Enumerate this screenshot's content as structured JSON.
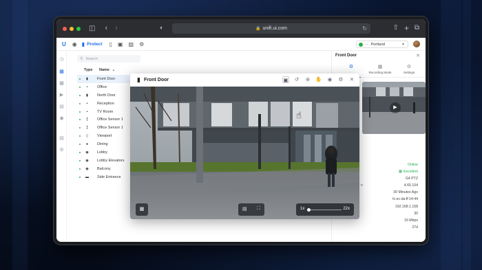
{
  "browser": {
    "url": "unifi.ui.com",
    "traffic_colors": [
      "#ff5f57",
      "#febc2e",
      "#28c840"
    ]
  },
  "toolbar": {
    "protect_label": "Protect",
    "site_name": "Portland"
  },
  "search": {
    "placeholder": "Search"
  },
  "table": {
    "col_type": "Type",
    "col_name": "Name",
    "rows": [
      {
        "name": "Front Door",
        "icon": "bullet-camera"
      },
      {
        "name": "Office",
        "icon": "mini-camera"
      },
      {
        "name": "North Door",
        "icon": "bullet-camera"
      },
      {
        "name": "Reception",
        "icon": "mini-camera"
      },
      {
        "name": "TV Room",
        "icon": "mini-camera"
      },
      {
        "name": "Office Sensor 1",
        "icon": "sensor"
      },
      {
        "name": "Office Sensor 1",
        "icon": "sensor"
      },
      {
        "name": "Viewport",
        "icon": "viewport"
      },
      {
        "name": "Dining",
        "icon": "dome-camera"
      },
      {
        "name": "Lobby",
        "icon": "turret-camera"
      },
      {
        "name": "Lobby Elevators",
        "icon": "turret-camera"
      },
      {
        "name": "Balcony",
        "icon": "turret-camera"
      },
      {
        "name": "Side Entrance",
        "icon": "doorbell"
      }
    ],
    "selected_index": 0
  },
  "detail": {
    "title": "Front Door",
    "tabs": [
      {
        "label": "",
        "icon": "settings-sliders-icon"
      },
      {
        "label": "Recording Mode",
        "icon": "calendar-icon"
      },
      {
        "label": "Settings",
        "icon": "gear-icon"
      }
    ],
    "label_fragment": "n",
    "values": {
      "status": "Online",
      "connection": "Excellent",
      "model": "G4 PTZ",
      "firmware": "4.65.104",
      "uptime": "30 Minutes Ago",
      "mac": "fc:ec:da:ff:14:44",
      "ip": "192.168.1.158",
      "fps": "30",
      "bitrate": "16 Mbps",
      "storage": "27d"
    },
    "status_color": "#23b14d"
  },
  "viewer": {
    "title": "Front Door",
    "tools": [
      "zoom-box-icon",
      "rotate-icon",
      "target-icon",
      "hand-icon",
      "camera-icon",
      "gear-icon",
      "close-icon"
    ],
    "zoom_min": "1x",
    "zoom_max": "22x",
    "zoom_level_fraction": 0.05
  }
}
